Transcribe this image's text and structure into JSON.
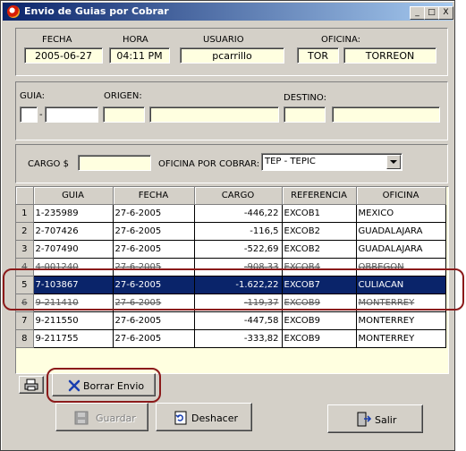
{
  "window": {
    "title": "Envio de Guias por Cobrar"
  },
  "titlebar_buttons": [
    "_",
    "□",
    "X"
  ],
  "header": {
    "fecha": {
      "label": "FECHA",
      "value": "2005-06-27"
    },
    "hora": {
      "label": "HORA",
      "value": "04:11 PM"
    },
    "usuario": {
      "label": "USUARIO",
      "value": "pcarrillo"
    },
    "oficina": {
      "label": "OFICINA:",
      "code": "TOR",
      "name": "TORREON"
    }
  },
  "guia_panel": {
    "guia_label": "GUIA:",
    "sep": "-",
    "origen_label": "ORIGEN:",
    "destino_label": "DESTINO:"
  },
  "cargo_panel": {
    "cargo_label": "CARGO  $",
    "oficina_label": "OFICINA POR COBRAR:",
    "oficina_value": "TEP - TEPIC"
  },
  "table": {
    "columns": [
      "GUIA",
      "FECHA",
      "CARGO",
      "REFERENCIA",
      "OFICINA"
    ],
    "rows": [
      {
        "n": "1",
        "guia": "1-235989",
        "fecha": "27-6-2005",
        "cargo": "-446,22",
        "ref": "EXCOB1",
        "oficina": "MEXICO"
      },
      {
        "n": "2",
        "guia": "2-707426",
        "fecha": "27-6-2005",
        "cargo": "-116,5",
        "ref": "EXCOB2",
        "oficina": "GUADALAJARA"
      },
      {
        "n": "3",
        "guia": "2-707490",
        "fecha": "27-6-2005",
        "cargo": "-522,69",
        "ref": "EXCOB2",
        "oficina": "GUADALAJARA"
      },
      {
        "n": "4",
        "guia": "4-001240",
        "fecha": "27-6-2005",
        "cargo": "-908,33",
        "ref": "EXCOB4",
        "oficina": "OBREGON"
      },
      {
        "n": "5",
        "guia": "7-103867",
        "fecha": "27-6-2005",
        "cargo": "-1.622,22",
        "ref": "EXCOB7",
        "oficina": "CULIACAN"
      },
      {
        "n": "6",
        "guia": "9-211410",
        "fecha": "27-6-2005",
        "cargo": "-119,37",
        "ref": "EXCOB9",
        "oficina": "MONTERREY"
      },
      {
        "n": "7",
        "guia": "9-211550",
        "fecha": "27-6-2005",
        "cargo": "-447,58",
        "ref": "EXCOB9",
        "oficina": "MONTERREY"
      },
      {
        "n": "8",
        "guia": "9-211755",
        "fecha": "27-6-2005",
        "cargo": "-333,82",
        "ref": "EXCOB9",
        "oficina": "MONTERREY"
      }
    ]
  },
  "buttons": {
    "borrar": "Borrar Envio",
    "guardar": "Guardar",
    "deshacer": "Deshacer",
    "salir": "Salir"
  },
  "colors": {
    "selection": "#0a246a",
    "highlight_ring": "#8b1a1a",
    "field_bg": "#ffffe0"
  }
}
